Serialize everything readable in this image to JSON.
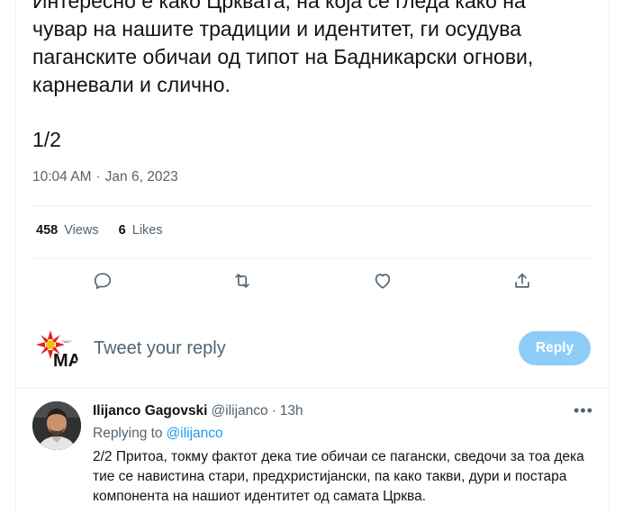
{
  "tweet": {
    "text": "Интересно е како Црквата, на која се гледа како на\nчувар на нашите традиции и идентитет, ги осудува\nпаганските обичаи од типот на Бадникарски огнови,\nкарневали и слично.",
    "counter": "1/2",
    "time": "10:04 AM",
    "separator": "·",
    "date": "Jan 6, 2023"
  },
  "stats": {
    "views_count": "458",
    "views_label": "Views",
    "likes_count": "6",
    "likes_label": "Likes"
  },
  "actions": [
    "reply-icon",
    "retweet-icon",
    "like-icon",
    "share-icon"
  ],
  "composer": {
    "placeholder": "Tweet your reply",
    "button_label": "Reply",
    "avatar_text": "MA",
    "avatar_small_text": "ПАКТ"
  },
  "reply": {
    "name": "Ilijanco Gagovski",
    "handle": "@ilijanco",
    "dot": "·",
    "time": "13h",
    "more": "•••",
    "replying_label": "Replying to",
    "replying_to": "@ilijanco",
    "text": "2/2 Притоа, токму фактот дека тие обичаи се пагански, сведочи за тоа дека тие се навистина стари, предхристијански, па како такви, дури и постара компонента на нашиот идентитет од самата Црква."
  },
  "colors": {
    "text_primary": "#0f1419",
    "text_secondary": "#536471",
    "accent": "#1d9bf0",
    "reply_button_disabled": "#8ecdf8",
    "divider": "#eff3f4"
  }
}
